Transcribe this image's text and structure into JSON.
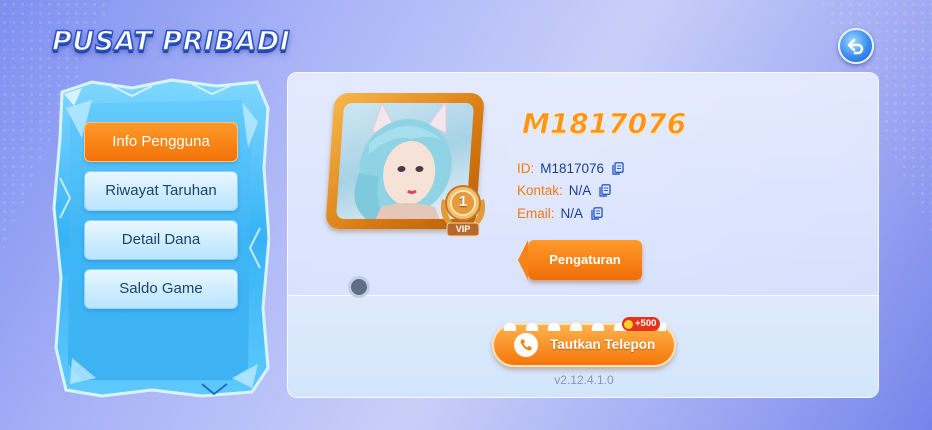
{
  "header": {
    "title": "PUSAT PRIBADI",
    "back_icon": "back-arrow-icon"
  },
  "sidebar": {
    "items": [
      {
        "label": "Info Pengguna",
        "active": true
      },
      {
        "label": "Riwayat Taruhan",
        "active": false
      },
      {
        "label": "Detail Dana",
        "active": false
      },
      {
        "label": "Saldo Game",
        "active": false
      }
    ]
  },
  "profile": {
    "username": "M1817076",
    "vip_level": "1",
    "vip_label": "VIP",
    "id_label": "ID:",
    "id_value": "M1817076",
    "contact_label": "Kontak:",
    "contact_value": "N/A",
    "email_label": "Email:",
    "email_value": "N/A",
    "settings_label": "Pengaturan"
  },
  "bind_phone": {
    "label": "Tautkan Telepon",
    "reward": "+500"
  },
  "version": "v2.12.4.1.0",
  "colors": {
    "accent": "#f57c0f",
    "text_blue": "#1c3d8f"
  }
}
